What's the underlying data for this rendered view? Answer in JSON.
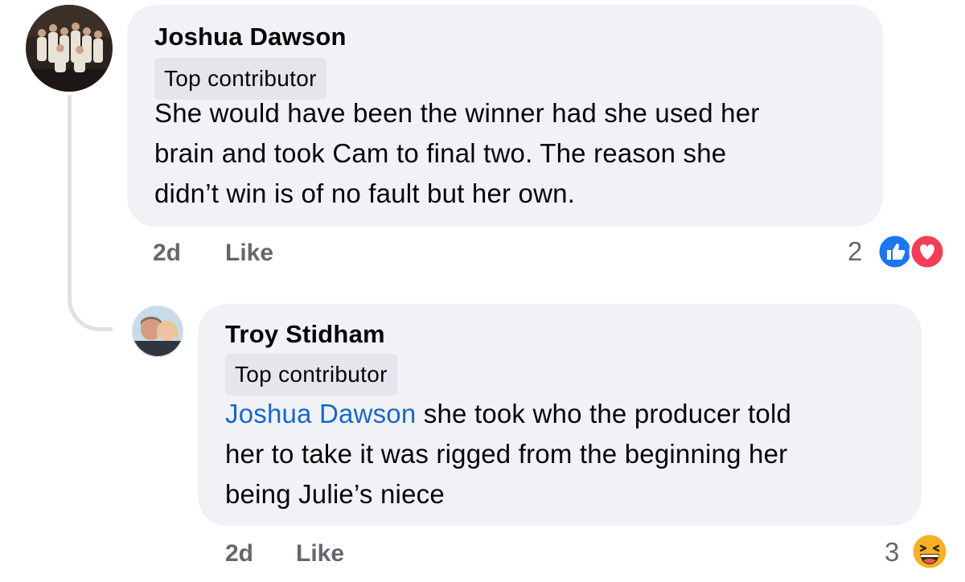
{
  "comments": [
    {
      "author": "Joshua Dawson",
      "badge": "Top contributor",
      "lines": [
        "She would have been the winner had she used her",
        "brain and took Cam to final two. The reason she",
        "didn’t win is of no fault but her own."
      ],
      "time": "2d",
      "like_label": "Like",
      "reaction_count": "2",
      "reactions": [
        "like-reaction-icon",
        "love-reaction-icon"
      ]
    },
    {
      "author": "Troy Stidham",
      "badge": "Top contributor",
      "mention": "Joshua Dawson",
      "lines": [
        " she took who the producer told",
        "her to take it was rigged from the beginning her",
        "being Julie’s niece"
      ],
      "time": "2d",
      "like_label": "Like",
      "reaction_count": "3",
      "reactions": [
        "haha-reaction-icon"
      ]
    }
  ],
  "colors": {
    "bubble": "#f0f2f5",
    "badge": "#e4e6eb",
    "mention": "#1a66cc",
    "meta": "#65676b",
    "like": "#1877f2",
    "love": "#f33e58",
    "haha": "#f7b125"
  }
}
